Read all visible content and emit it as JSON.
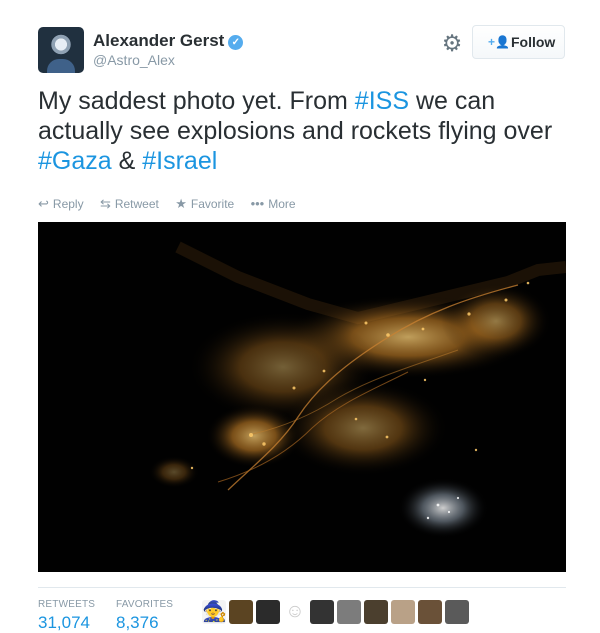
{
  "profile": {
    "name": "Alexander Gerst",
    "handle": "@Astro_Alex",
    "verified_icon": "verified-badge-icon",
    "avatar_icon": "astronaut-avatar"
  },
  "controls": {
    "gear_icon": "gear-icon",
    "follow_label": "Follow",
    "follow_icon": "add-user-icon"
  },
  "tweet": {
    "segments": [
      {
        "text": "My saddest photo yet. From ",
        "kind": "text"
      },
      {
        "text": "#ISS",
        "kind": "hashtag"
      },
      {
        "text": " we can actually see explosions and rockets flying over ",
        "kind": "text"
      },
      {
        "text": "#Gaza",
        "kind": "hashtag"
      },
      {
        "text": " & ",
        "kind": "text"
      },
      {
        "text": "#Israel",
        "kind": "hashtag"
      }
    ]
  },
  "actions": [
    {
      "label": "Reply",
      "icon": "reply-icon",
      "glyph": "↩"
    },
    {
      "label": "Retweet",
      "icon": "retweet-icon",
      "glyph": "⇆"
    },
    {
      "label": "Favorite",
      "icon": "star-icon",
      "glyph": "★"
    },
    {
      "label": "More",
      "icon": "more-icon",
      "glyph": "•••"
    }
  ],
  "stats": {
    "retweets_label": "RETWEETS",
    "retweets_value": "31,074",
    "favorites_label": "FAVORITES",
    "favorites_value": "8,376"
  },
  "colors": {
    "hashtag": "#1b95e0",
    "verified": "#55acee",
    "muted": "#8899a6"
  },
  "favorite_avatars": [
    "avatar-1",
    "avatar-2",
    "avatar-3",
    "avatar-4",
    "avatar-5",
    "avatar-6",
    "avatar-7",
    "avatar-8",
    "avatar-9",
    "avatar-10"
  ]
}
